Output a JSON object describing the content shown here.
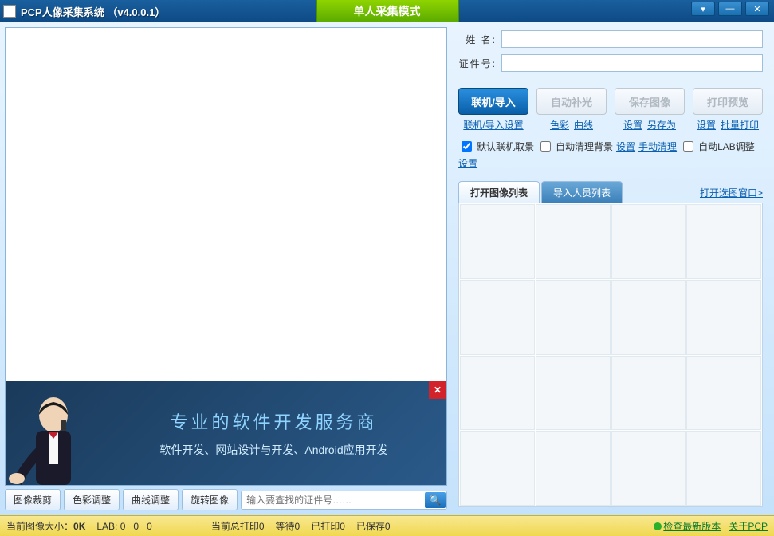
{
  "titlebar": {
    "title": "PCP人像采集系统  （v4.0.0.1）",
    "mode_banner": "单人采集模式"
  },
  "form": {
    "name_label": "姓  名:",
    "id_label": "证件号:"
  },
  "actions": {
    "connect": "联机/导入",
    "auto_light": "自动补光",
    "save_image": "保存图像",
    "print_preview": "打印预览"
  },
  "links": {
    "col1": [
      "联机/导入设置"
    ],
    "col2": [
      "色彩",
      "曲线"
    ],
    "col3": [
      "设置",
      "另存为"
    ],
    "col4": [
      "设置",
      "批量打印"
    ]
  },
  "checks": {
    "default_connect": "默认联机取景",
    "auto_clean_bg": "自动清理背景",
    "auto_clean_set": "设置",
    "manual_clean": "手动清理",
    "auto_lab": "自动LAB调整",
    "lab_set": "设置"
  },
  "tabs": {
    "open_list": "打开图像列表",
    "import_list": "导入人员列表",
    "open_window": "打开选图窗口>"
  },
  "toolbar": {
    "crop": "图像裁剪",
    "color": "色彩调整",
    "curve": "曲线调整",
    "rotate": "旋转图像",
    "search_placeholder": "输入要查找的证件号……"
  },
  "ad": {
    "big": "专业的软件开发服务商",
    "small": "软件开发、网站设计与开发、Android应用开发"
  },
  "status": {
    "img_size_label": "当前图像大小：",
    "img_size_val": "0K",
    "lab_label": "LAB:",
    "lab_l": "0",
    "lab_a": "0",
    "lab_b": "0",
    "total_print": "当前总打印0",
    "waiting": "等待0",
    "printed": "已打印0",
    "saved": "已保存0",
    "check_update": "检查最新版本",
    "about": "关于PCP"
  }
}
